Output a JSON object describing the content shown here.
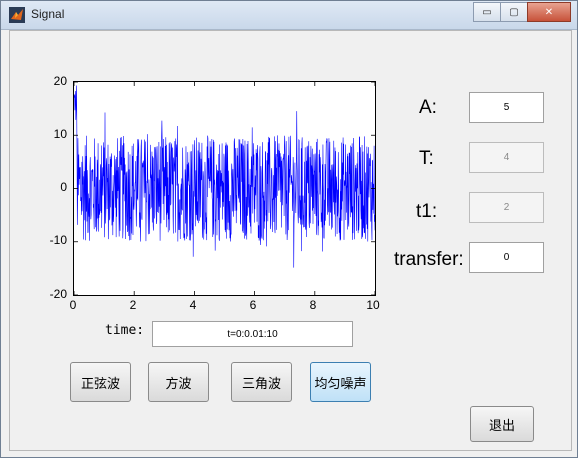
{
  "window": {
    "title": "Signal",
    "minimize": "▭",
    "maximize": "▢",
    "close": "✕"
  },
  "plot": {
    "y_ticks": [
      "20",
      "10",
      "0",
      "-10",
      "-20"
    ],
    "x_ticks": [
      "0",
      "2",
      "4",
      "6",
      "8",
      "10"
    ]
  },
  "params": {
    "a_label": "A:",
    "a_value": "5",
    "t_label": "T:",
    "t_value": "4",
    "t1_label": "t1:",
    "t1_value": "2",
    "transfer_label": "transfer:",
    "transfer_value": "0"
  },
  "time": {
    "label": "time:",
    "value": "t=0:0.01:10"
  },
  "buttons": {
    "sine": "正弦波",
    "square": "方波",
    "triangle": "三角波",
    "noise": "均匀噪声",
    "exit": "退出"
  },
  "chart_data": {
    "type": "line",
    "xlim": [
      0,
      10
    ],
    "ylim": [
      -20,
      20
    ],
    "grid": false,
    "series_color": "#0000ff"
  }
}
